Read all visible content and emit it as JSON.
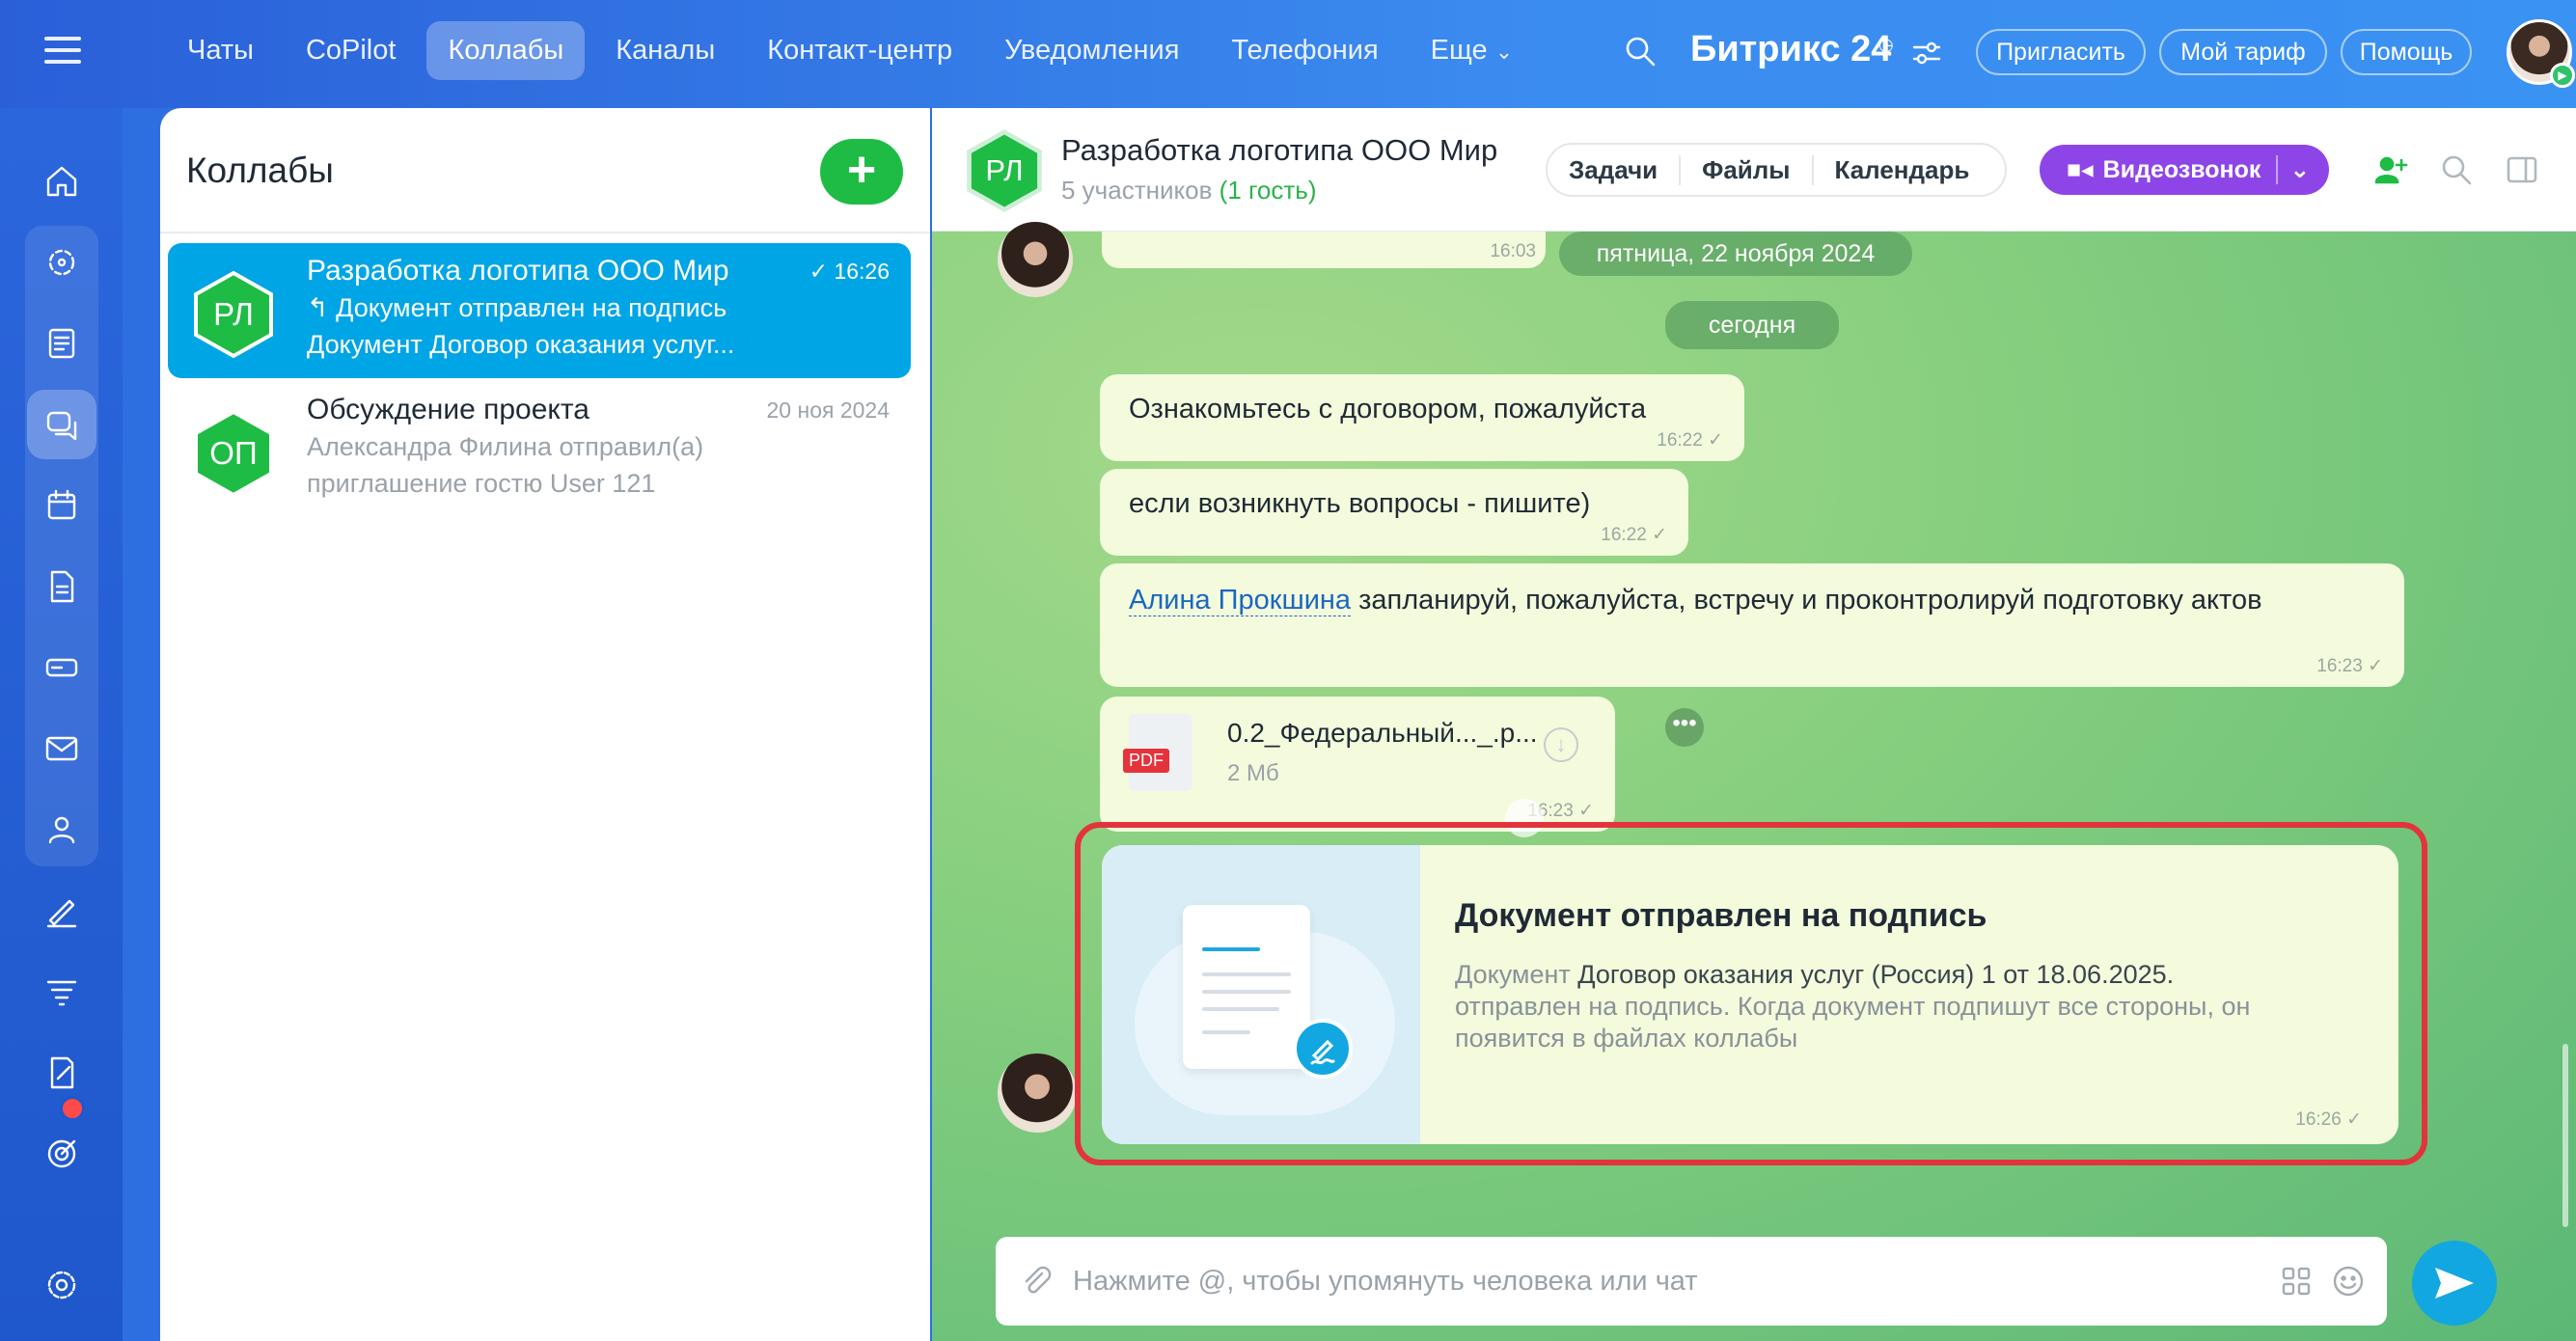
{
  "topbar": {
    "tabs": [
      {
        "label": "Чаты"
      },
      {
        "label": "CoPilot"
      },
      {
        "label": "Коллабы",
        "active": true
      },
      {
        "label": "Каналы"
      },
      {
        "label": "Контакт-центр"
      },
      {
        "label": "Уведомления"
      },
      {
        "label": "Телефония"
      },
      {
        "label": "Еще"
      }
    ],
    "brand": "Битрикс 24",
    "invite": "Пригласить",
    "tariff": "Мой тариф",
    "help": "Помощь"
  },
  "colors": {
    "accent": "#1ebc45",
    "active_item": "#00a5e6",
    "video": "#8e45e8",
    "highlight": "#e2343c"
  },
  "list": {
    "title": "Коллабы",
    "add_label": "+",
    "items": [
      {
        "initials": "РЛ",
        "name": "Разработка логотипа ООО Мир",
        "time": "16:26",
        "line2": "Документ отправлен на подпись",
        "line3": "Документ Договор оказания услуг...",
        "active": true
      },
      {
        "initials": "ОП",
        "name": "Обсуждение проекта",
        "time": "20 ноя 2024",
        "line2": "Александра Филина отправил(а)",
        "line3": "приглашение гостю User 121",
        "active": false
      }
    ]
  },
  "chat": {
    "initials": "РЛ",
    "title": "Разработка логотипа ООО Мир",
    "participants": "5 участников",
    "guest": "(1 гость)",
    "tabs": [
      "Задачи",
      "Файлы",
      "Календарь"
    ],
    "video": "Видеозвонок",
    "date_chip": "пятница, 22 ноября 2024",
    "prev_time": "16:03",
    "today_chip": "сегодня",
    "messages": [
      {
        "text": "Ознакомьтесь с договором, пожалуйста",
        "time": "16:22"
      },
      {
        "text": "если возникнуть вопросы - пишите)",
        "time": "16:22"
      },
      {
        "mention": "Алина Прокшина",
        "text": " запланируй, пожалуйста, встречу и проконтролируй подготовку актов",
        "time": "16:23"
      }
    ],
    "file": {
      "name": "0.2_Федеральный..._.p...",
      "size": "2 Мб",
      "badge": "PDF",
      "time": "16:23"
    },
    "sign_card": {
      "title": "Документ отправлен на подпись",
      "prefix": "Документ ",
      "doc": "Договор оказания услуг (Россия) 1 от 18.06.2025.",
      "rest": "отправлен на подпись. Когда документ подпишут все стороны, он появится в файлах коллабы",
      "time": "16:26"
    },
    "input_placeholder": "Нажмите @, чтобы упомянуть человека или чат"
  },
  "icons": [
    "menu-icon",
    "home-icon",
    "feed-icon",
    "tasks-icon",
    "chat-icon",
    "calendar-icon",
    "docs-icon",
    "drive-icon",
    "mail-icon",
    "contacts-icon",
    "sign-icon",
    "filter-icon",
    "forms-icon",
    "target-icon",
    "settings-icon"
  ]
}
